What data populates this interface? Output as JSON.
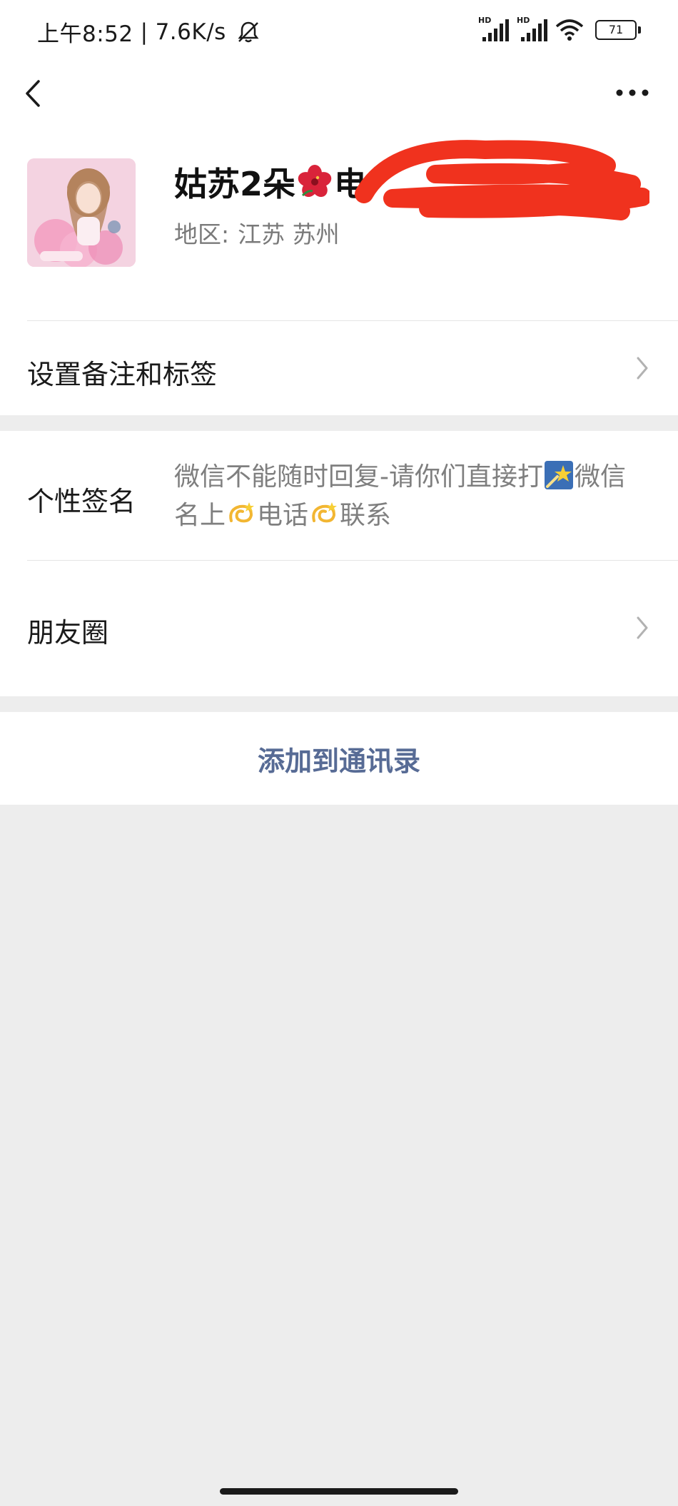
{
  "status_bar": {
    "time": "上午8:52",
    "speed": "7.6K/s",
    "hd_label": "HD",
    "battery": "71"
  },
  "profile": {
    "name_prefix": "姑苏2朵",
    "name_after_flower": "电",
    "region_label": "地区:",
    "region_value": "江苏   苏州"
  },
  "rows": {
    "remark_label": "设置备注和标签",
    "signature_label": "个性签名",
    "signature_part1": "微信不能随时回复-请你们直接打",
    "signature_part2": "微信名上",
    "signature_part3": "电话",
    "signature_part4": "联系",
    "moments_label": "朋友圈"
  },
  "actions": {
    "add_contact": "添加到通讯录"
  },
  "colors": {
    "link_blue": "#576b95",
    "background": "#ededed",
    "redaction_red": "#f0321e"
  }
}
